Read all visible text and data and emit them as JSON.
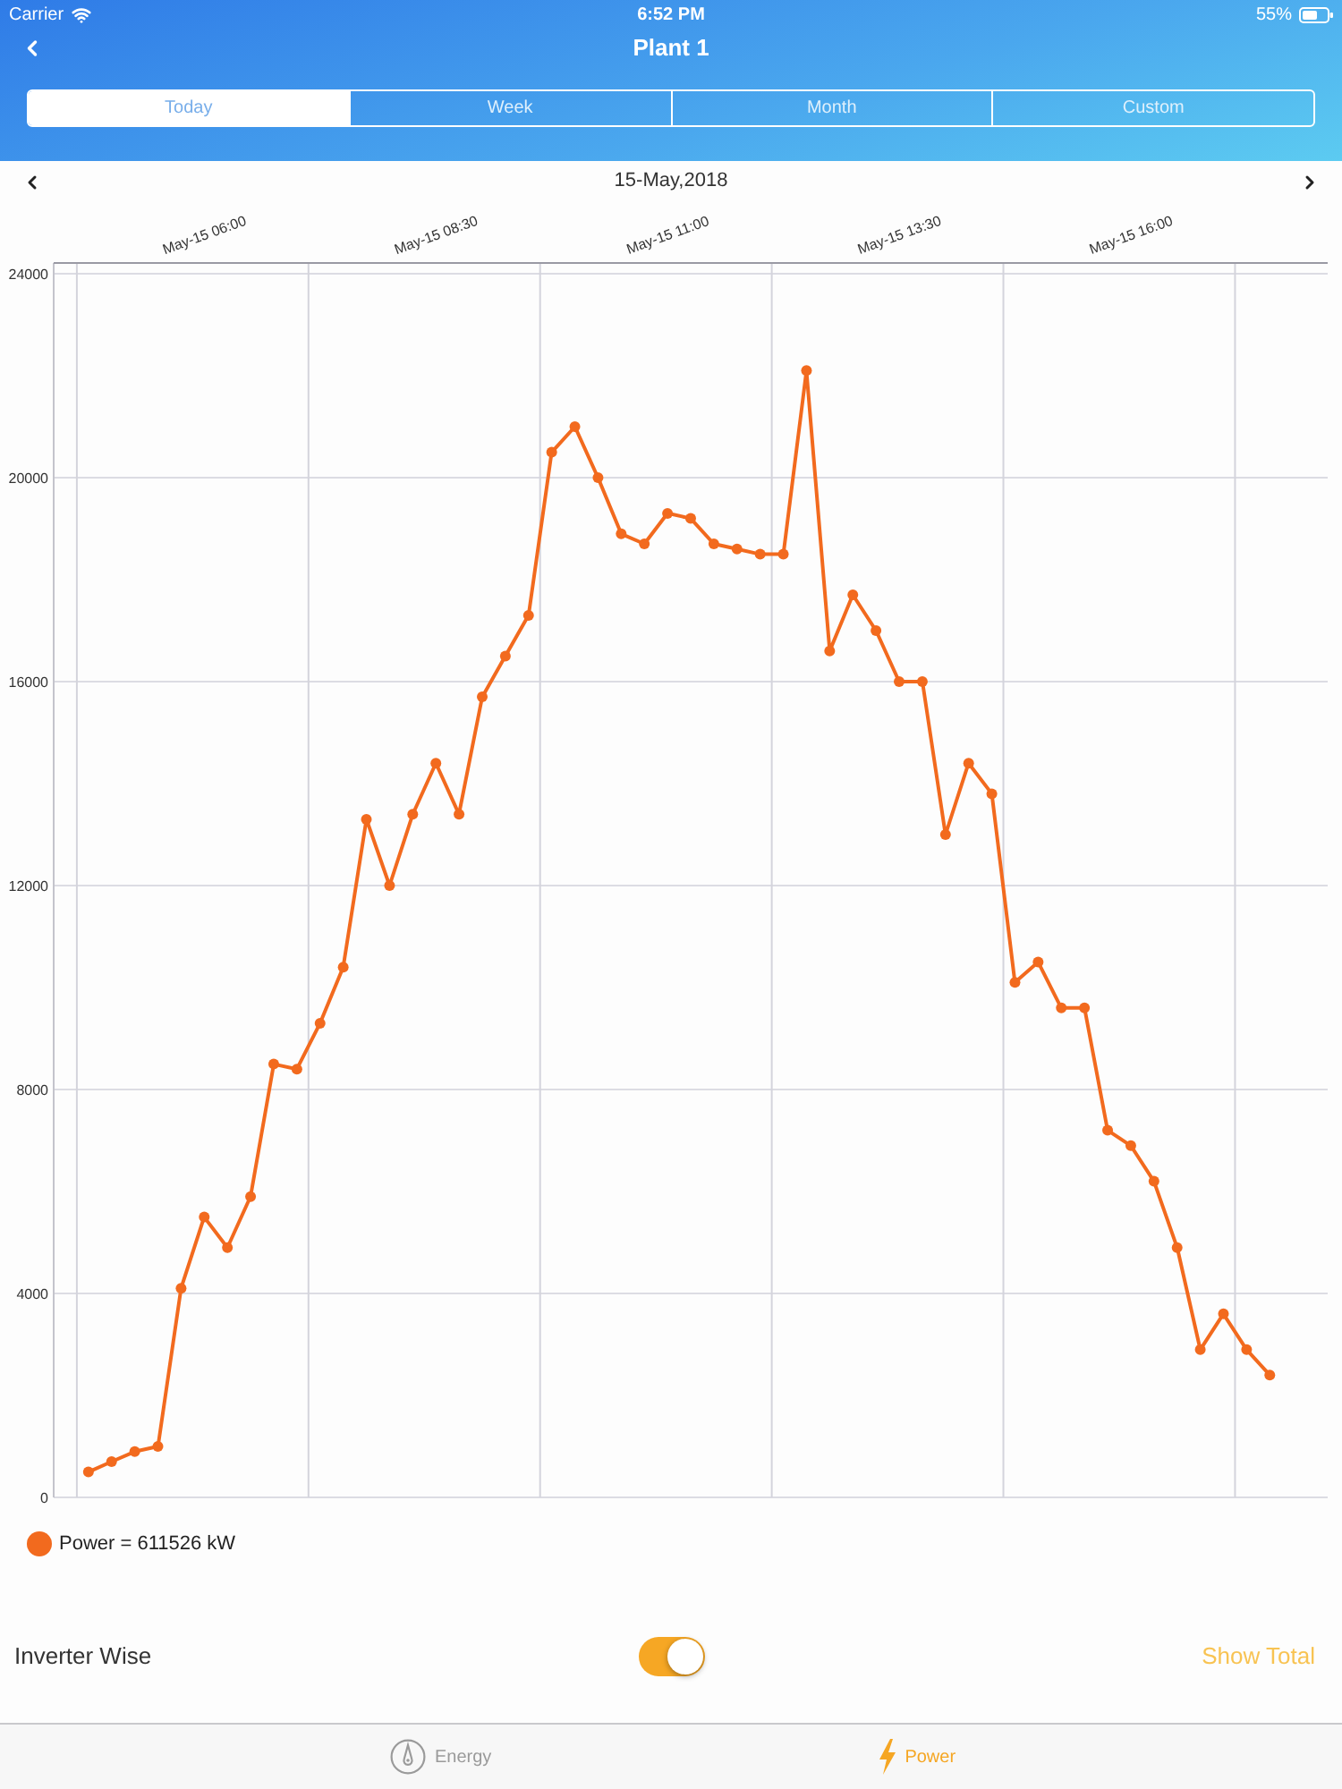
{
  "status_bar": {
    "carrier": "Carrier",
    "time": "6:52 PM",
    "battery": "55%"
  },
  "nav": {
    "title": "Plant 1"
  },
  "tabs": [
    {
      "label": "Today",
      "selected": true
    },
    {
      "label": "Week",
      "selected": false
    },
    {
      "label": "Month",
      "selected": false
    },
    {
      "label": "Custom",
      "selected": false
    }
  ],
  "date_nav": {
    "date": "15-May,2018"
  },
  "chart": {
    "chart_data": {
      "type": "line",
      "grid": true,
      "categories": [
        null,
        null,
        null,
        null,
        null,
        "May-15 06:00",
        null,
        null,
        null,
        null,
        null,
        null,
        null,
        null,
        null,
        "May-15 08:30",
        null,
        null,
        null,
        null,
        null,
        null,
        null,
        null,
        null,
        "May-15 11:00",
        null,
        null,
        null,
        null,
        null,
        null,
        null,
        null,
        null,
        "May-15 13:30",
        null,
        null,
        null,
        null,
        null,
        null,
        null,
        null,
        null,
        "May-15 16:00",
        null,
        null,
        null,
        null,
        null,
        null
      ],
      "ylim": [
        0,
        24000
      ],
      "yticks": [
        0,
        4000,
        8000,
        12000,
        16000,
        20000,
        24000
      ],
      "series": [
        {
          "color": "#f26a1e",
          "marker": "circle",
          "values": [
            500,
            700,
            900,
            1000,
            4100,
            5500,
            4900,
            5900,
            8500,
            8400,
            9300,
            10400,
            13300,
            12000,
            13400,
            14400,
            13400,
            15700,
            16500,
            17300,
            20500,
            21000,
            20000,
            18900,
            18700,
            19300,
            19200,
            18700,
            18600,
            18500,
            18500,
            22100,
            16600,
            17700,
            17000,
            16000,
            16000,
            13000,
            14400,
            13800,
            10100,
            10500,
            9600,
            9600,
            7200,
            6900,
            6200,
            4900,
            2900,
            3600,
            2900,
            2400
          ]
        }
      ]
    }
  },
  "legend": {
    "label": "Power = 611526 kW"
  },
  "inverter_wise": {
    "label": "Inverter Wise",
    "on": true
  },
  "show_total": {
    "label": "Show Total"
  },
  "tab_bar": [
    {
      "label": "Energy",
      "selected": false
    },
    {
      "label": "Power",
      "selected": true
    }
  ]
}
